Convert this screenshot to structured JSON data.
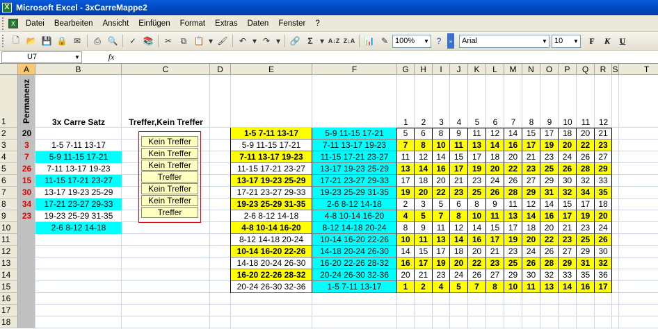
{
  "window": {
    "title": "Microsoft Excel - 3xCarreMappe2"
  },
  "menu": [
    "Datei",
    "Bearbeiten",
    "Ansicht",
    "Einfügen",
    "Format",
    "Extras",
    "Daten",
    "Fenster",
    "?"
  ],
  "toolbar": {
    "zoom": "100%",
    "font": "Arial",
    "size": "10",
    "bold": "F",
    "italic": "K",
    "underline": "U"
  },
  "formula": {
    "namebox": "U7",
    "fx": "fx",
    "value": ""
  },
  "columns": [
    "A",
    "B",
    "C",
    "D",
    "E",
    "F",
    "G",
    "H",
    "I",
    "J",
    "K",
    "L",
    "M",
    "N",
    "O",
    "P",
    "Q",
    "R",
    "S",
    "T"
  ],
  "rows": [
    "1",
    "2",
    "3",
    "4",
    "5",
    "6",
    "7",
    "8",
    "9",
    "10",
    "11",
    "12",
    "13",
    "14",
    "15",
    "16",
    "17",
    "18"
  ],
  "header": {
    "a1": "Permanenz",
    "b1": "3x Carre Satz",
    "c1": "Treffer,Kein Treffer",
    "nums": [
      "1",
      "2",
      "3",
      "4",
      "5",
      "6",
      "7",
      "8",
      "9",
      "10",
      "11",
      "12"
    ]
  },
  "col_a": [
    "20",
    "3",
    "7",
    "26",
    "15",
    "30",
    "34",
    "23"
  ],
  "col_b": [
    "1-5 7-11 13-17",
    "5-9 11-15 17-21",
    "7-11 13-17 19-23",
    "11-15 17-21 23-27",
    "13-17 19-23 25-29",
    "17-21 23-27 29-33",
    "19-23 25-29 31-35",
    "2-6 8-12 14-18"
  ],
  "col_c": [
    "Kein Treffer",
    "Kein Treffer",
    "Kein Treffer",
    "Treffer",
    "Kein Treffer",
    "Kein Treffer",
    "Treffer"
  ],
  "col_e": [
    "1-5 7-11 13-17",
    "5-9 11-15 17-21",
    "7-11 13-17 19-23",
    "11-15 17-21 23-27",
    "13-17 19-23 25-29",
    "17-21 23-27 29-33",
    "19-23 25-29 31-35",
    "2-6 8-12 14-18",
    "4-8 10-14 16-20",
    "8-12 14-18 20-24",
    "10-14 16-20 22-26",
    "14-18 20-24 26-30",
    "16-20 22-26 28-32",
    "20-24 26-30 32-36"
  ],
  "col_f": [
    "5-9 11-15 17-21",
    "7-11 13-17 19-23",
    "11-15 17-21 23-27",
    "13-17 19-23 25-29",
    "17-21 23-27 29-33",
    "19-23 25-29 31-35",
    "2-6 8-12 14-18",
    "4-8 10-14 16-20",
    "8-12 14-18 20-24",
    "10-14 16-20 22-26",
    "14-18 20-24 26-30",
    "16-20 22-26 28-32",
    "20-24 26-30 32-36",
    "1-5 7-11 13-17"
  ],
  "matrix": [
    [
      "5",
      "6",
      "8",
      "9",
      "11",
      "12",
      "14",
      "15",
      "17",
      "18",
      "20",
      "21"
    ],
    [
      "7",
      "8",
      "10",
      "11",
      "13",
      "14",
      "16",
      "17",
      "19",
      "20",
      "22",
      "23"
    ],
    [
      "11",
      "12",
      "14",
      "15",
      "17",
      "18",
      "20",
      "21",
      "23",
      "24",
      "26",
      "27"
    ],
    [
      "13",
      "14",
      "16",
      "17",
      "19",
      "20",
      "22",
      "23",
      "25",
      "26",
      "28",
      "29"
    ],
    [
      "17",
      "18",
      "20",
      "21",
      "23",
      "24",
      "26",
      "27",
      "29",
      "30",
      "32",
      "33"
    ],
    [
      "19",
      "20",
      "22",
      "23",
      "25",
      "26",
      "28",
      "29",
      "31",
      "32",
      "34",
      "35"
    ],
    [
      "2",
      "3",
      "5",
      "6",
      "8",
      "9",
      "11",
      "12",
      "14",
      "15",
      "17",
      "18"
    ],
    [
      "4",
      "5",
      "7",
      "8",
      "10",
      "11",
      "13",
      "14",
      "16",
      "17",
      "19",
      "20"
    ],
    [
      "8",
      "9",
      "11",
      "12",
      "14",
      "15",
      "17",
      "18",
      "20",
      "21",
      "23",
      "24"
    ],
    [
      "10",
      "11",
      "13",
      "14",
      "16",
      "17",
      "19",
      "20",
      "22",
      "23",
      "25",
      "26"
    ],
    [
      "14",
      "15",
      "17",
      "18",
      "20",
      "21",
      "23",
      "24",
      "26",
      "27",
      "29",
      "30"
    ],
    [
      "16",
      "17",
      "19",
      "20",
      "22",
      "23",
      "25",
      "26",
      "28",
      "29",
      "31",
      "32"
    ],
    [
      "20",
      "21",
      "23",
      "24",
      "26",
      "27",
      "29",
      "30",
      "32",
      "33",
      "35",
      "36"
    ],
    [
      "1",
      "2",
      "4",
      "5",
      "7",
      "8",
      "10",
      "11",
      "13",
      "14",
      "16",
      "17"
    ]
  ],
  "colors": {
    "yellow": "#ffff00",
    "cyan": "#00ffff",
    "red": "#e00000"
  }
}
